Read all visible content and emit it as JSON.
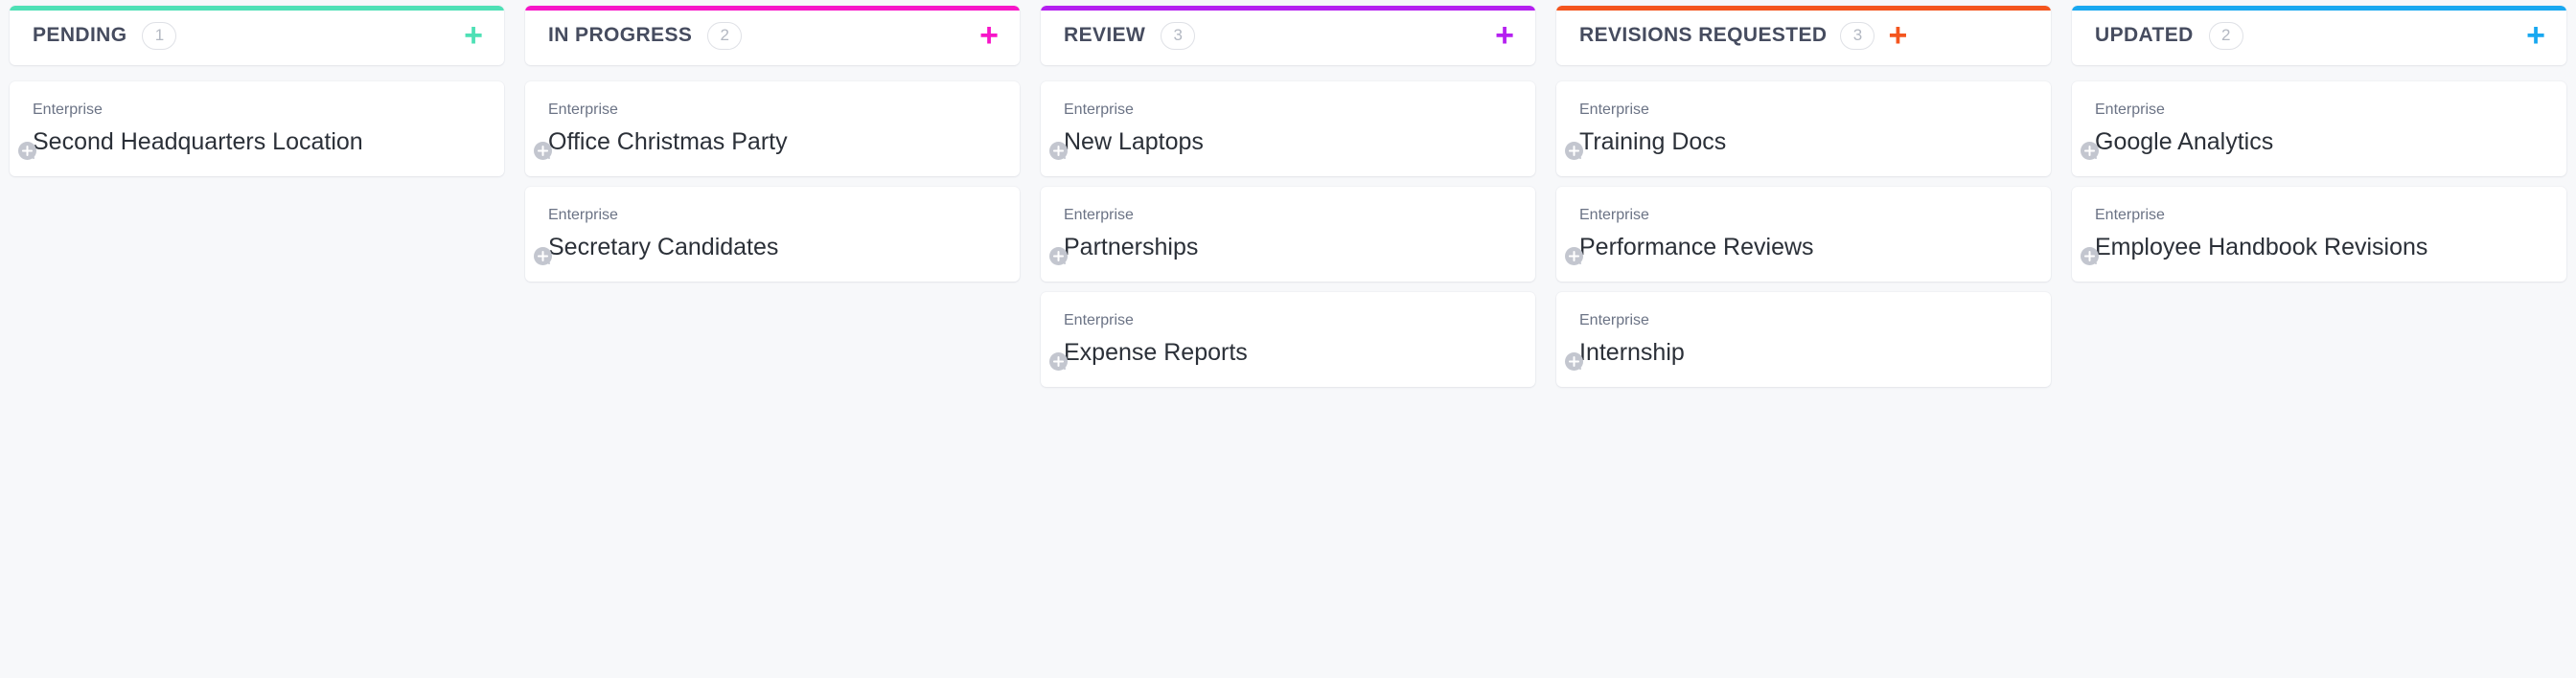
{
  "board": {
    "background_color": "#f7f8fa",
    "columns": [
      {
        "title": "PENDING",
        "count": "1",
        "accent_color": "#4ee0b5",
        "add_label": "+",
        "add_icon": "plus-icon",
        "cards": [
          {
            "tag": "Enterprise",
            "title": "Second Headquarters Location",
            "avatar_icon": "add-assignee-avatar-icon"
          }
        ]
      },
      {
        "title": "IN PROGRESS",
        "count": "2",
        "accent_color": "#f715c8",
        "add_label": "+",
        "add_icon": "plus-icon",
        "cards": [
          {
            "tag": "Enterprise",
            "title": "Office Christmas Party",
            "avatar_icon": "add-assignee-avatar-icon"
          },
          {
            "tag": "Enterprise",
            "title": "Secretary Candidates",
            "avatar_icon": "add-assignee-avatar-icon"
          }
        ]
      },
      {
        "title": "REVIEW",
        "count": "3",
        "accent_color": "#b520f0",
        "add_label": "+",
        "add_icon": "plus-icon",
        "cards": [
          {
            "tag": "Enterprise",
            "title": "New Laptops",
            "avatar_icon": "add-assignee-avatar-icon"
          },
          {
            "tag": "Enterprise",
            "title": "Partnerships",
            "avatar_icon": "add-assignee-avatar-icon"
          },
          {
            "tag": "Enterprise",
            "title": "Expense Reports",
            "avatar_icon": "add-assignee-avatar-icon"
          }
        ]
      },
      {
        "title": "REVISIONS REQUESTED",
        "count": "3",
        "accent_color": "#f4551e",
        "add_label": "+",
        "add_icon": "plus-icon",
        "cards": [
          {
            "tag": "Enterprise",
            "title": "Training Docs",
            "avatar_icon": "add-assignee-avatar-icon"
          },
          {
            "tag": "Enterprise",
            "title": "Performance Reviews",
            "avatar_icon": "add-assignee-avatar-icon"
          },
          {
            "tag": "Enterprise",
            "title": "Internship",
            "avatar_icon": "add-assignee-avatar-icon"
          }
        ]
      },
      {
        "title": "UPDATED",
        "count": "2",
        "accent_color": "#19a8f0",
        "add_label": "+",
        "add_icon": "plus-icon",
        "cards": [
          {
            "tag": "Enterprise",
            "title": "Google Analytics",
            "avatar_icon": "add-assignee-avatar-icon"
          },
          {
            "tag": "Enterprise",
            "title": "Employee Handbook Revisions",
            "avatar_icon": "add-assignee-avatar-icon"
          }
        ]
      }
    ]
  }
}
